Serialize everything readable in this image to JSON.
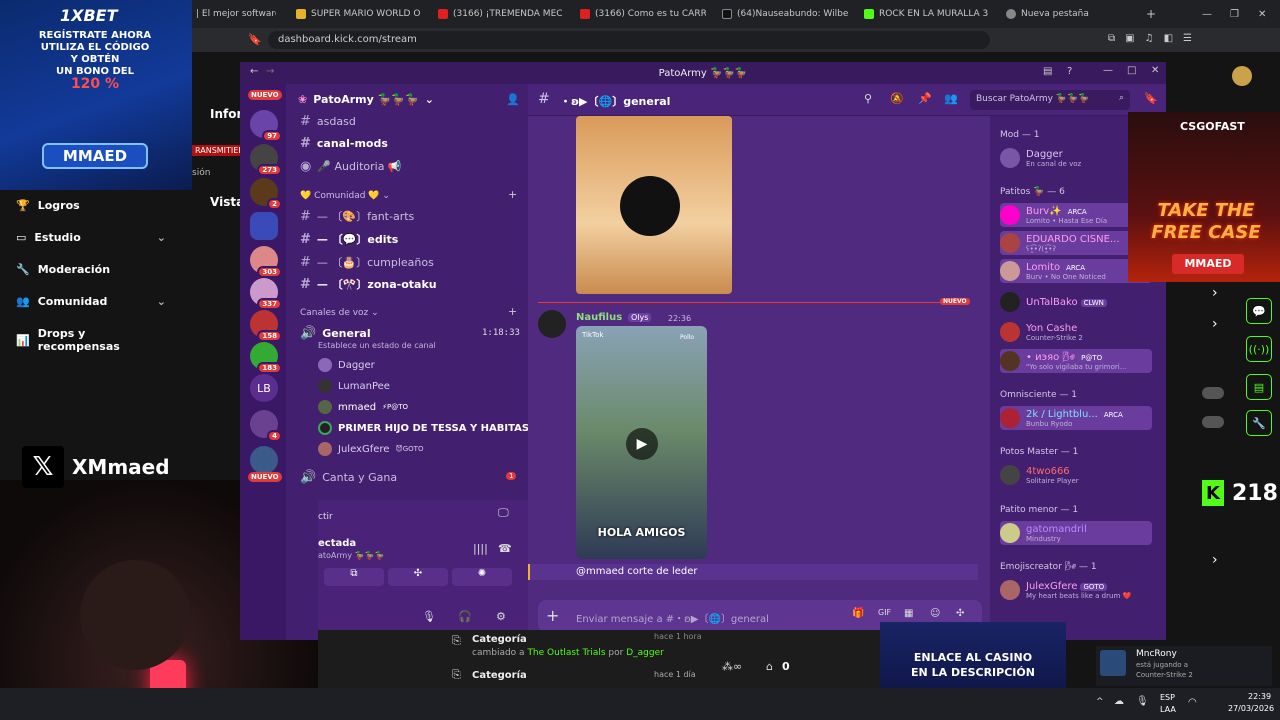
{
  "browser": {
    "tabs": [
      "| El mejor software par",
      "SUPER MARIO WORLD ONLIN",
      "(3166) ¡TREMENDA MECHA",
      "(3166) Como es tu CARRO si la",
      "(64)Nauseabundo: Wilber Mc",
      "ROCK EN LA MURALLA 3 | Join",
      "Nueva pestaña"
    ],
    "url": "dashboard.kick.com/stream"
  },
  "ad_1xbet": {
    "brand": "1XBET",
    "line1": "REGÍSTRATE AHORA",
    "line2": "UTILIZA EL CÓDIGO",
    "line3": "Y OBTÉN",
    "line4": "UN BONO DEL",
    "bonus": "120 %",
    "code": "MMAED"
  },
  "dashboard_left": {
    "partial1": "Inforr",
    "partial2": "RANSMITIEN",
    "partial3": "sión",
    "partial4": "Vista",
    "nav": [
      {
        "label": "Logros",
        "icon": "trophy-icon",
        "chevron": false
      },
      {
        "label": "Estudio",
        "icon": "studio-icon",
        "chevron": true
      },
      {
        "label": "Moderación",
        "icon": "wrench-icon",
        "chevron": false
      },
      {
        "label": "Comunidad",
        "icon": "people-icon",
        "chevron": true
      },
      {
        "label": "Drops y recompensas",
        "icon": "chart-icon",
        "chevron": false
      }
    ]
  },
  "overlay": {
    "x_handle": "XMmaed"
  },
  "discord": {
    "window_title": "PatoArmy 🦆🦆🦆",
    "server_name": "PatoArmy 🦆🦆🦆",
    "guild_badges": [
      "NUEVO",
      "97",
      "273",
      "2",
      "303",
      "337",
      "158",
      "183",
      "4",
      "NUEVO"
    ],
    "guild_text": "LB",
    "channels_top": [
      {
        "name": "asdasd",
        "bold": false
      },
      {
        "name": "canal-mods",
        "bold": true
      },
      {
        "name": "🎤 Auditoria 📢",
        "bold": false
      }
    ],
    "category_comunidad": "💛 Comunidad 💛",
    "channels_comunidad": [
      {
        "name": "— 〔🎨〕fant-arts",
        "bold": false
      },
      {
        "name": "— 〔💬〕edits",
        "bold": true
      },
      {
        "name": "— 〔🎂〕cumpleaños",
        "bold": false
      },
      {
        "name": "— 〔🎌〕zona-otaku",
        "bold": true
      }
    ],
    "category_voice": "Canales de voz",
    "voice_channel": {
      "name": "General",
      "time": "1:18:33",
      "status": "Establece un estado de canal"
    },
    "voice_users": [
      {
        "name": "Dagger"
      },
      {
        "name": "LumanPee"
      },
      {
        "name": "mmaed",
        "tag": "⚡P@TO"
      },
      {
        "name": "PRIMER HIJO DE TESSA Y HABITAS"
      },
      {
        "name": "JulexGfere",
        "tag": "😈GOTO"
      }
    ],
    "voice_channel_2": {
      "name": "Canta y Gana",
      "badge": "1"
    },
    "user_panel": {
      "partial1": "ctir",
      "status": "ectada",
      "server": "atoArmy 🦆🦆🦆"
    },
    "chat_header": {
      "channel": "・ʚ▶〔🌐〕general",
      "search_placeholder": "Buscar PatoArmy 🦆🦆🦆"
    },
    "new_divider": "NUEVO",
    "message": {
      "author": "Naufilus",
      "author_tag": "Olys",
      "time": "22:36",
      "video_source": "TikTok",
      "video_caption": "HOLA AMIGOS",
      "video_corner": "Pollo",
      "reply_text": "@mmaed  corte de leder"
    },
    "input_placeholder": "Enviar mensaje a #・ʚ▶〔🌐〕general",
    "members": {
      "groups": [
        {
          "title": "Mod — 1",
          "members": [
            {
              "name": "Dagger",
              "sub": "En canal de voz",
              "color": "#d9c7f0"
            }
          ]
        },
        {
          "title": "Patitos 🦆 — 6",
          "members": [
            {
              "name": "Burv✨",
              "tag": "ARCA",
              "sub": "Lomito • Hasta Ese Día",
              "color": "#ff9cf0"
            },
            {
              "name": "EDUARDO CISNE...",
              "sub": "ʕ•̫͡•ʔ(•̫͡•ʔ",
              "color": "#ff9cf0"
            },
            {
              "name": "Lomito",
              "tag": "ARCA",
              "sub": "Burv • No One Noticed",
              "color": "#ff9cf0"
            },
            {
              "name": "UnTalBako",
              "tag": "CLWN",
              "sub": "",
              "color": "#ff9cf0"
            },
            {
              "name": "Yon Cashe",
              "sub": "Counter-Strike 2",
              "color": "#ff9cf0"
            },
            {
              "name": "• иэяо 🌬",
              "tag": "P@TO",
              "sub": "\"Yo solo vigilaba tu grimori...",
              "color": "#ff9cf0"
            }
          ]
        },
        {
          "title": "Omnisciente — 1",
          "members": [
            {
              "name": "2k / Lightblu...",
              "tag": "ARCA",
              "sub": "Bunbu Ryodo",
              "color": "#7fe0ff"
            }
          ]
        },
        {
          "title": "Potos Master — 1",
          "members": [
            {
              "name": "4two666",
              "sub": "Solitaire Player",
              "color": "#ff6b6b"
            }
          ]
        },
        {
          "title": "Patito menor — 1",
          "members": [
            {
              "name": "gatomandril",
              "sub": "Mindustry",
              "color": "#b88bff"
            }
          ]
        },
        {
          "title": "Emojiscreator 🌬 — 1",
          "members": [
            {
              "name": "JulexGfere",
              "tag": "GOTO",
              "sub": "My heart beats like a drum ❤️",
              "color": "#ff9cf0"
            }
          ]
        }
      ]
    }
  },
  "ad_csgo": {
    "brand": "CSGOFAST",
    "line1": "TAKE THE",
    "line2": "FREE CASE",
    "code": "MMAED"
  },
  "ad_casino": {
    "line1": "ENLACE AL CASINO",
    "line2": "EN LA DESCRIPCIÓN"
  },
  "right_dash": {
    "viewers": "218"
  },
  "bottom_dash": {
    "row1_title": "Categoría",
    "row1_sub_prefix": "cambiado a",
    "row1_game": "The Outlast Trials",
    "row1_by": "por",
    "row1_user": "D_agger",
    "row1_time": "hace 1 hora",
    "row2_title": "Categoría",
    "row2_time": "hace 1 día",
    "count": "0"
  },
  "notification": {
    "user": "MncRony",
    "line1": "está jugando a",
    "line2": "Counter-Strike 2"
  },
  "taskbar": {
    "lang1": "ESP",
    "lang2": "LAA",
    "time": "22:39",
    "date": "27/03/2026"
  }
}
